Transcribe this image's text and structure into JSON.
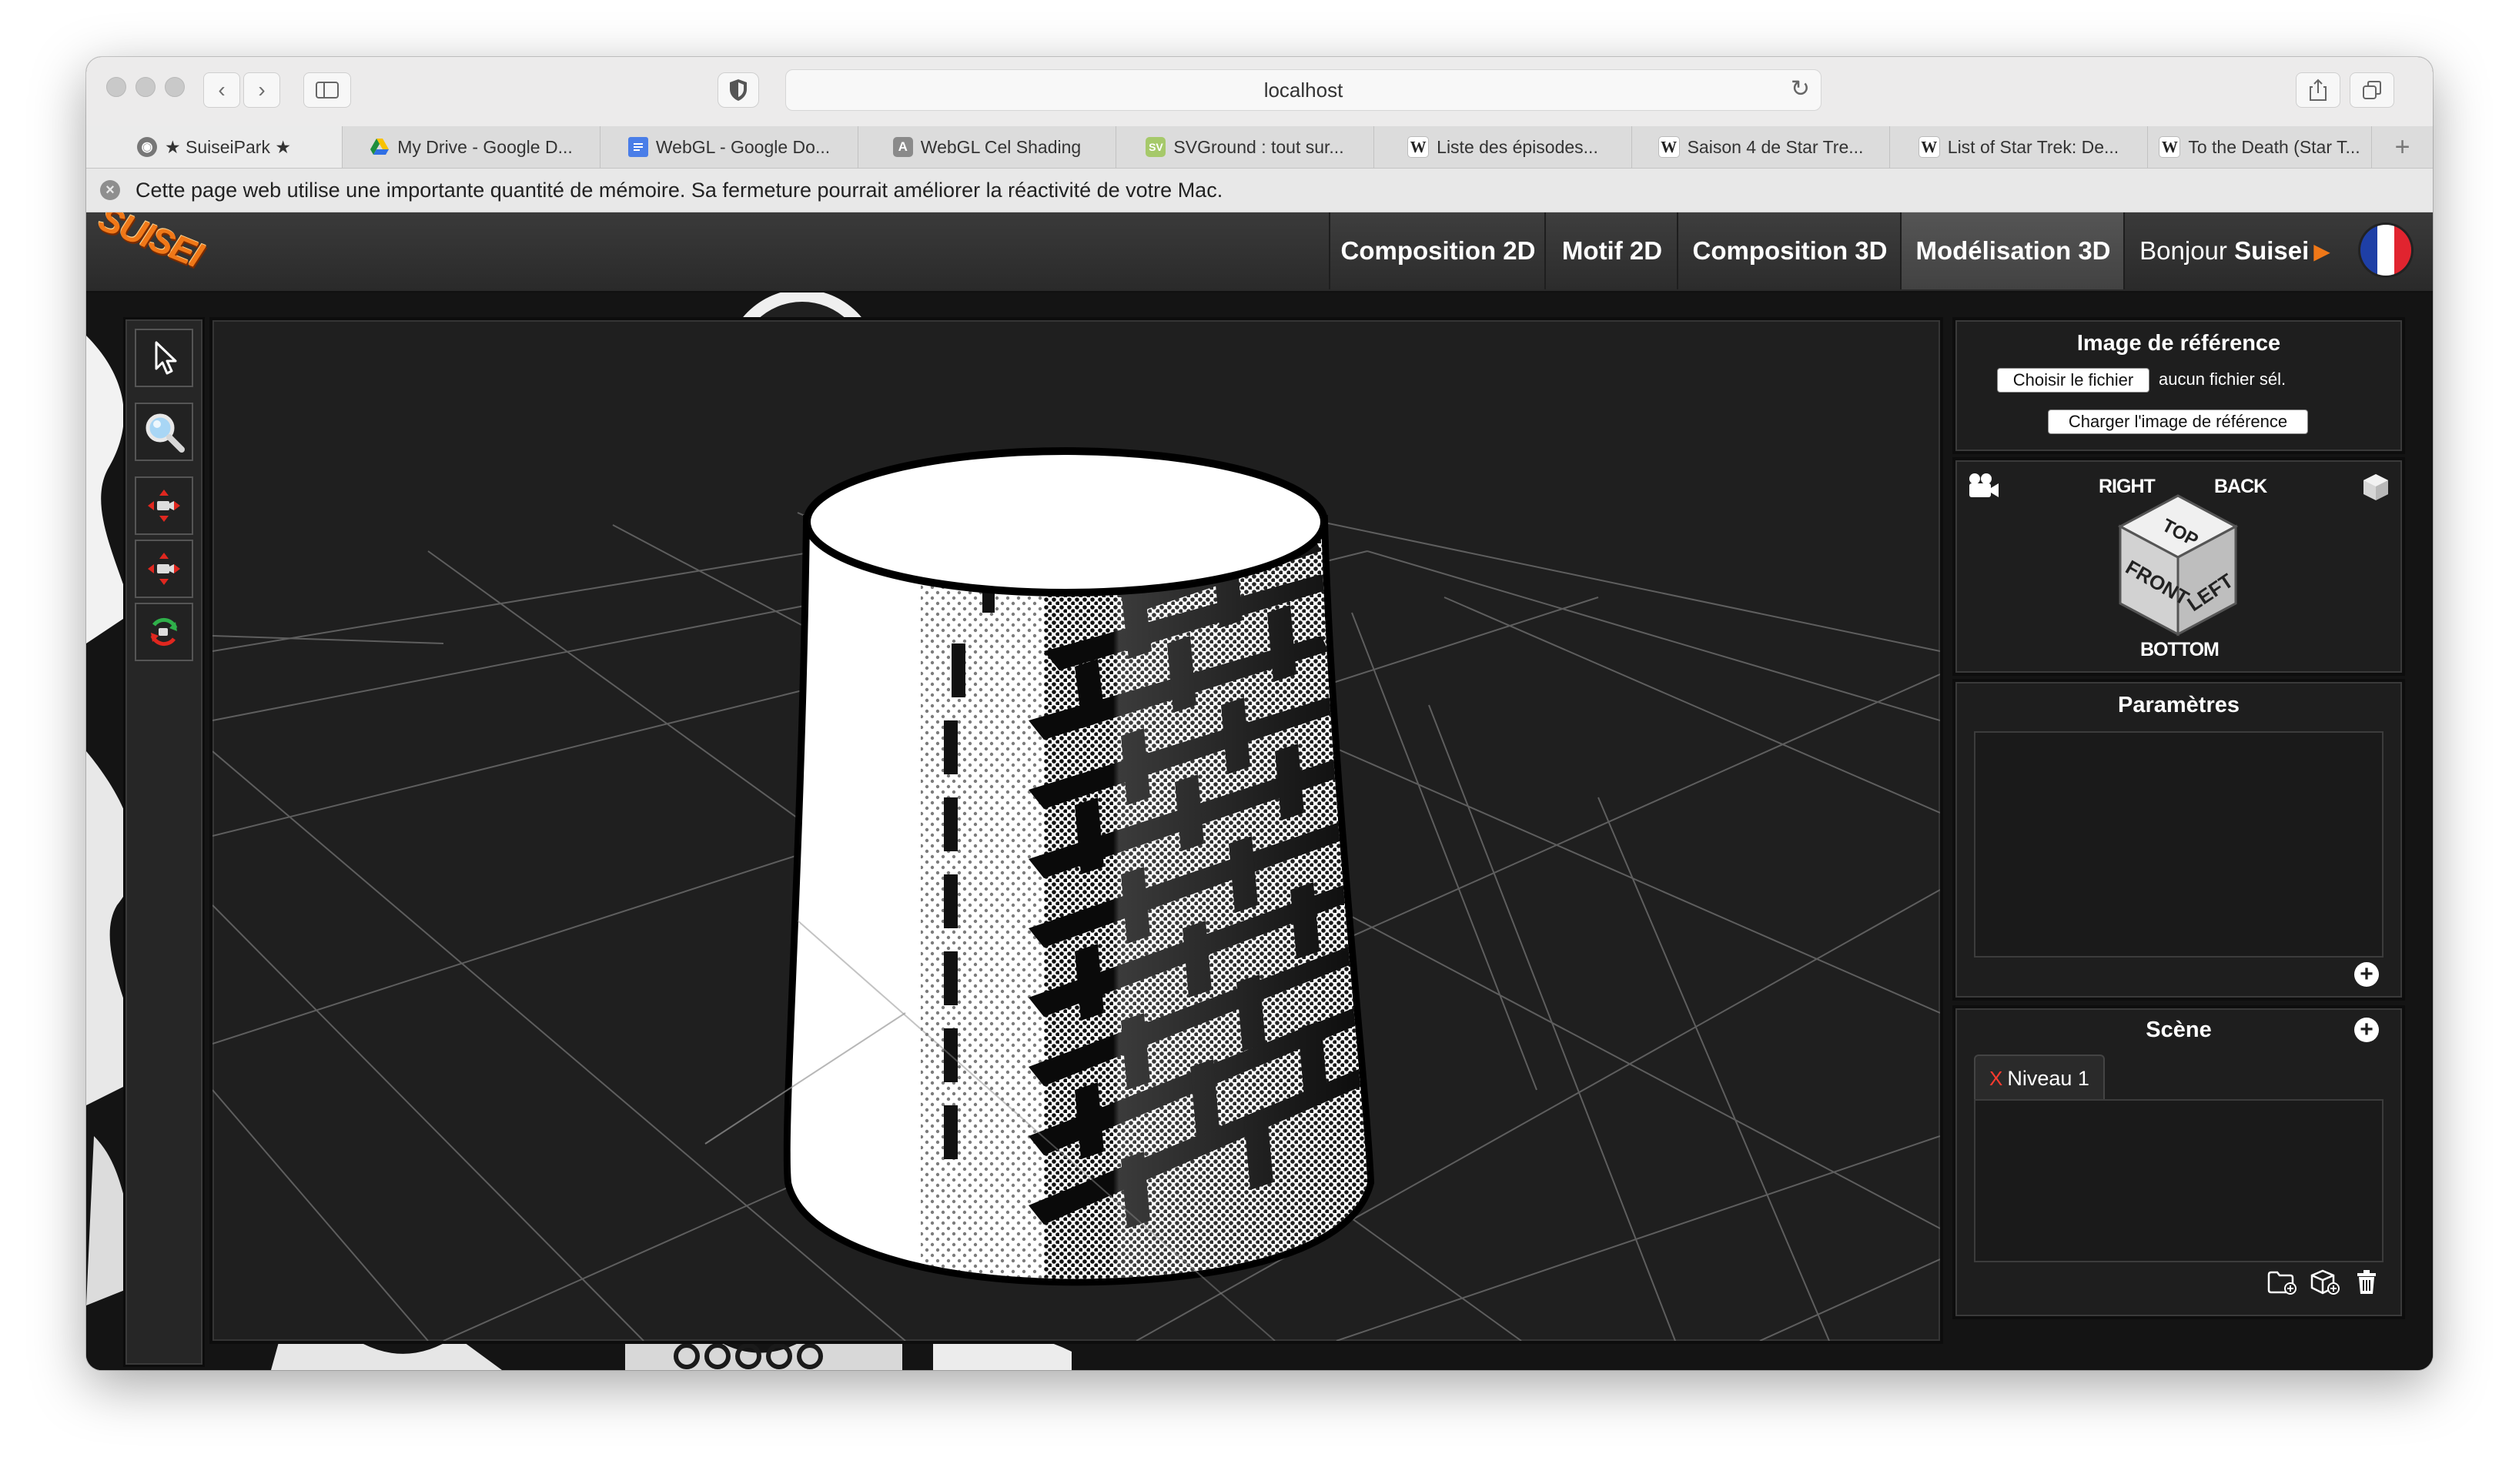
{
  "browser": {
    "url": "localhost",
    "tabs": [
      {
        "title": "★ SuiseiPark ★",
        "icon": "github-icon"
      },
      {
        "title": "My Drive - Google D...",
        "icon": "google-drive-icon"
      },
      {
        "title": "WebGL - Google Do...",
        "icon": "google-docs-icon"
      },
      {
        "title": "WebGL Cel Shading",
        "icon": "a-letter-icon"
      },
      {
        "title": "SVGround : tout sur...",
        "icon": "svg-icon"
      },
      {
        "title": "Liste des épisodes...",
        "icon": "wikipedia-icon"
      },
      {
        "title": "Saison 4 de Star Tre...",
        "icon": "wikipedia-icon"
      },
      {
        "title": "List of Star Trek: De...",
        "icon": "wikipedia-icon"
      },
      {
        "title": "To the Death (Star T...",
        "icon": "wikipedia-icon"
      }
    ],
    "new_tab_label": "+",
    "notice": "Cette page web utilise une importante quantité de mémoire. Sa fermeture pourrait améliorer la réactivité de votre Mac."
  },
  "app": {
    "logo": "SUISEI",
    "nav": [
      {
        "label": "Composition 2D",
        "active": false
      },
      {
        "label": "Motif 2D",
        "active": false
      },
      {
        "label": "Composition 3D",
        "active": false
      },
      {
        "label": "Modélisation 3D",
        "active": true
      }
    ],
    "greeting": {
      "prefix": "Bonjour ",
      "name": "Suisei"
    },
    "tools": [
      "select-arrow-icon",
      "zoom-magnifier-icon",
      "pan-camera-icon",
      "move-camera-icon",
      "rotate-camera-icon"
    ],
    "reference_panel": {
      "title": "Image de référence",
      "choose_file": "Choisir le fichier",
      "no_file": "aucun fichier sél.",
      "load_button": "Charger l'image de référence"
    },
    "view_cube": {
      "right": "RIGHT",
      "back": "BACK",
      "top": "TOP",
      "front": "FRONT",
      "left": "LEFT",
      "bottom": "BOTTOM"
    },
    "parameters_panel": {
      "title": "Paramètres"
    },
    "scene_panel": {
      "title": "Scène",
      "levels": [
        {
          "name": "Niveau 1",
          "remove_label": "X"
        }
      ]
    }
  }
}
